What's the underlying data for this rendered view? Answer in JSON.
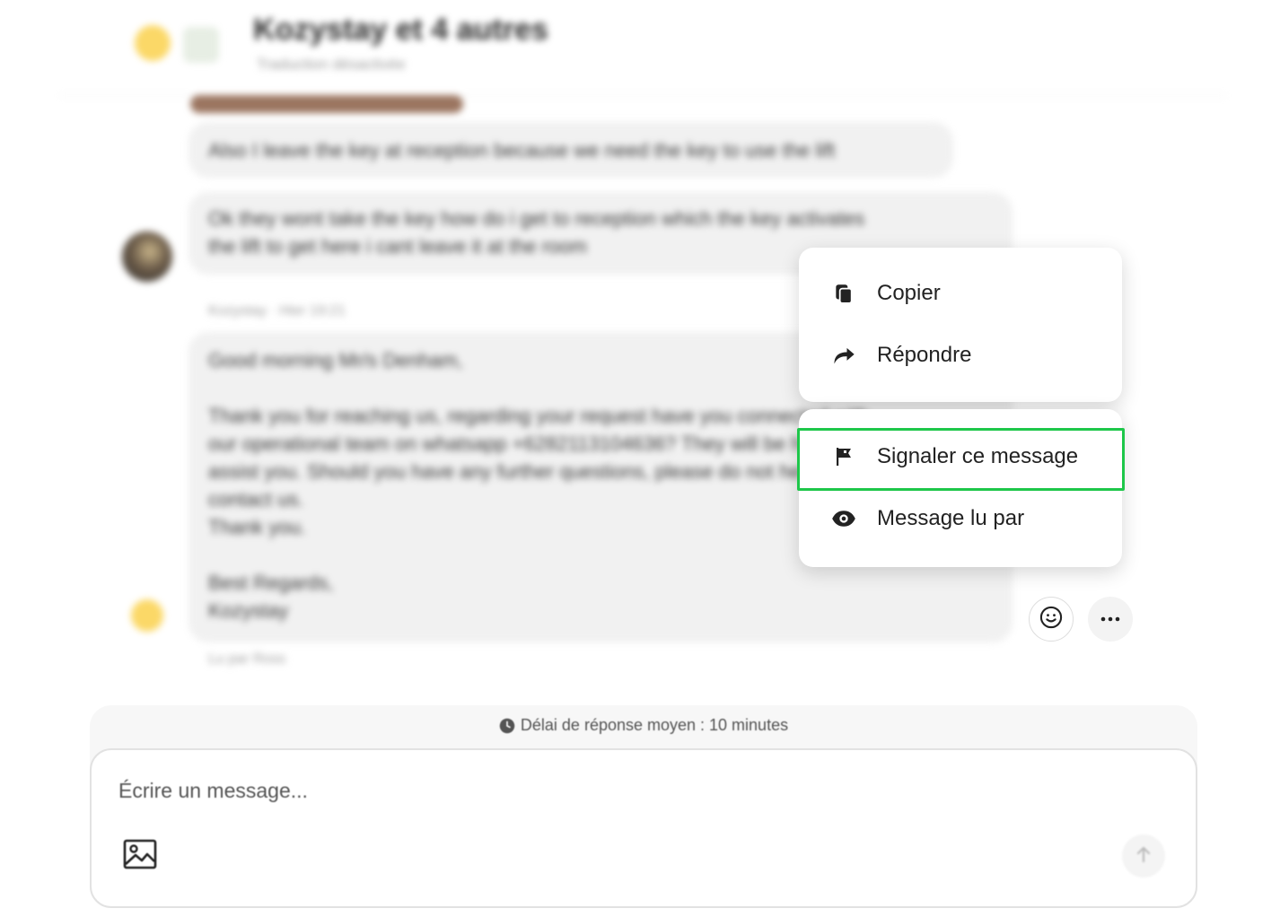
{
  "header": {
    "title": "Kozystay et 4 autres",
    "subtitle": "Traduction désactivée"
  },
  "messages": [
    {
      "lines": [
        "Also I leave the key at reception because we need the key to use the lift"
      ]
    },
    {
      "lines": [
        "Ok they wont take the key how do i get to reception which the key activates",
        "the lift to get here i cant leave it at the room"
      ]
    },
    {
      "sender_meta": "Kozystay · Hier 19:21",
      "lines": [
        "Good morning Mr/s Denham,",
        "",
        "Thank you for reaching us, regarding your request have you connected with",
        "our operational team on whatsapp +6282113104636? They will be happy to",
        "assist you. Should you have any further questions, please do not hesitate to",
        "contact us.",
        "Thank you.",
        "",
        "Best Regards,",
        "Kozystay"
      ],
      "status": "Lu par Ross"
    }
  ],
  "context_menu": {
    "top_group": [
      {
        "label": "Copier",
        "icon": "copy-icon"
      },
      {
        "label": "Répondre",
        "icon": "reply-arrow-icon"
      }
    ],
    "bottom_group": [
      {
        "label": "Signaler ce message",
        "icon": "flag-icon",
        "highlighted": true
      },
      {
        "label": "Message lu par",
        "icon": "eye-icon"
      }
    ]
  },
  "message_actions": {
    "emoji": "smiley-icon",
    "more": "ellipsis-icon"
  },
  "composer": {
    "response_time": "Délai de réponse moyen : 10 minutes",
    "placeholder": "Écrire un message..."
  },
  "colors": {
    "highlight": "#1ec74a",
    "bubble": "#f1f1f1",
    "avatar_yellow": "#fbd867"
  }
}
